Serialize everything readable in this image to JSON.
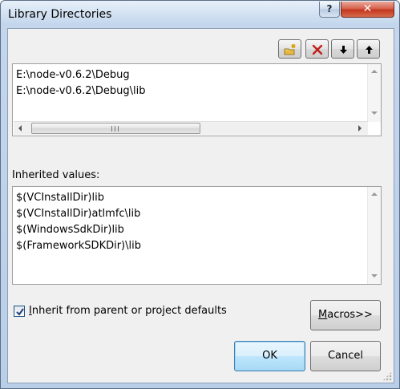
{
  "window": {
    "title": "Library Directories",
    "help_label": "?",
    "close_label": "✕"
  },
  "toolbar": {
    "icons": [
      "new-line-icon",
      "delete-icon",
      "move-down-icon",
      "move-up-icon"
    ]
  },
  "directories": {
    "items": [
      "E:\\node-v0.6.2\\Debug",
      "E:\\node-v0.6.2\\Debug\\lib"
    ]
  },
  "inherited": {
    "label": "Inherited values:",
    "items": [
      "$(VCInstallDir)lib",
      "$(VCInstallDir)atlmfc\\lib",
      "$(WindowsSdkDir)lib",
      "$(FrameworkSDKDir)\\lib"
    ]
  },
  "inherit_checkbox": {
    "checked": true,
    "label_prefix": "I",
    "label_rest": "nherit from parent or project defaults"
  },
  "buttons": {
    "macros_prefix": "M",
    "macros_rest": "acros>>",
    "ok_label": "OK",
    "cancel_label": "Cancel"
  },
  "colors": {
    "default_button_border": "#3c7fb1",
    "delete_icon": "#c0201d",
    "new_line_icon": "#e8b840"
  }
}
